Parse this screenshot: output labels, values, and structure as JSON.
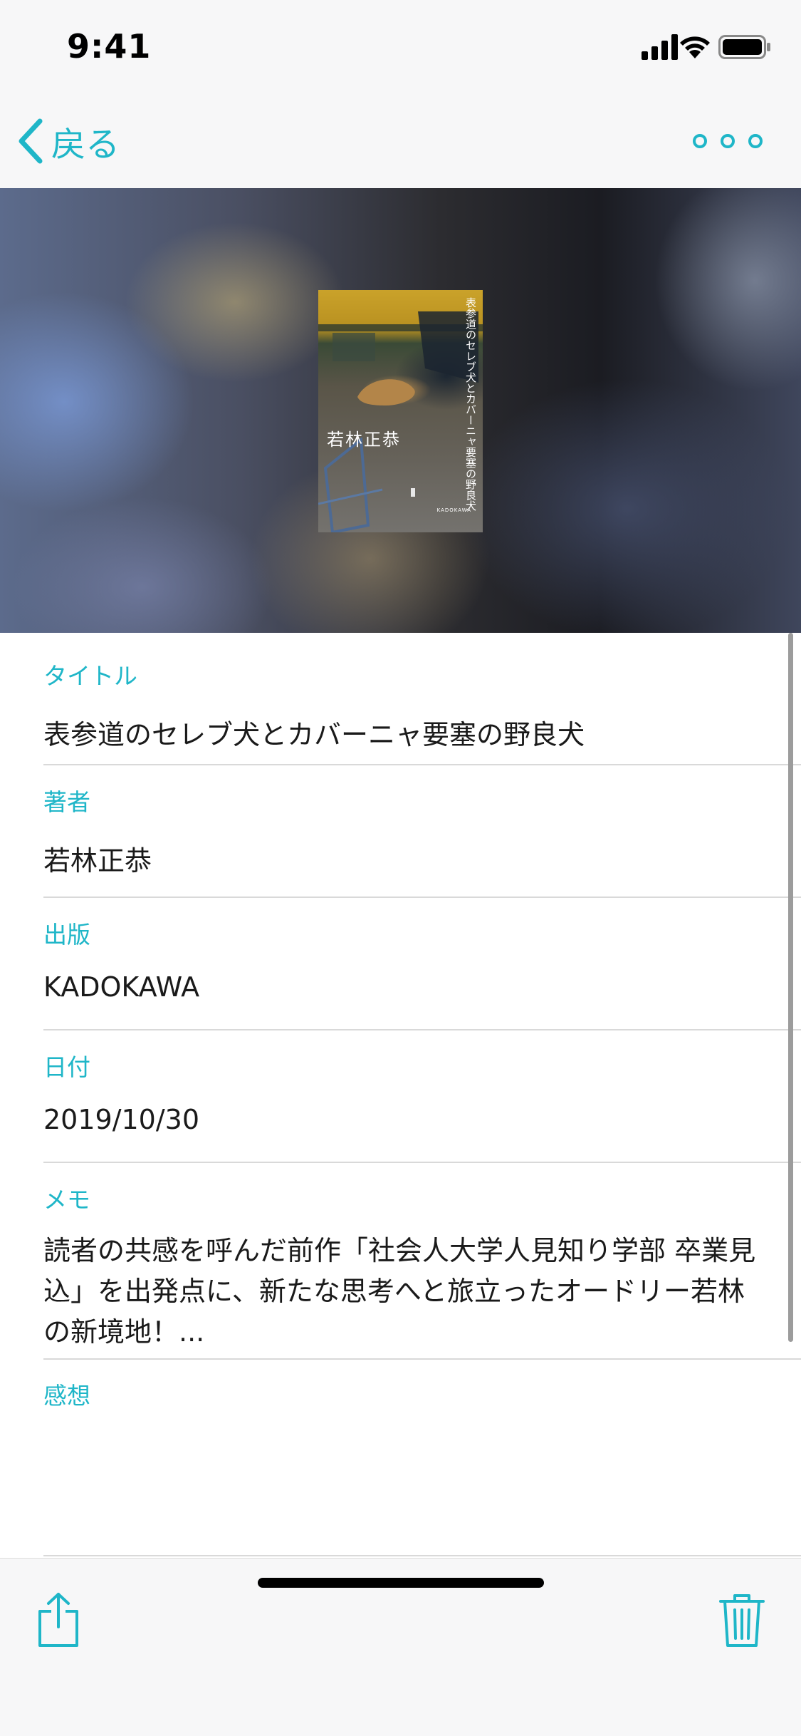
{
  "status_bar": {
    "time": "9:41",
    "icons": [
      "cellular-signal-icon",
      "wifi-icon",
      "battery-icon"
    ]
  },
  "nav": {
    "back_label": "戻る",
    "more_icon": "more-icon"
  },
  "book": {
    "cover_title": "表参道のセレブ犬とカバーニャ要塞の野良犬",
    "cover_author": "若林正恭",
    "cover_publisher": "KADOKAWA"
  },
  "fields": {
    "title": {
      "label": "タイトル",
      "value": "表参道のセレブ犬とカバーニャ要塞の野良犬"
    },
    "author": {
      "label": "著者",
      "value": "若林正恭"
    },
    "publisher": {
      "label": "出版",
      "value": "KADOKAWA"
    },
    "date": {
      "label": "日付",
      "value": "2019/10/30"
    },
    "memo": {
      "label": "メモ",
      "value": "読者の共感を呼んだ前作「社会人大学人見知り学部 卒業見込」を出発点に、新たな思考へと旅立ったオードリー若林の新境地！..."
    },
    "impression": {
      "label": "感想",
      "value": ""
    }
  },
  "toolbar": {
    "share_icon": "share-icon",
    "trash_icon": "trash-icon"
  },
  "colors": {
    "accent": "#1fb6c8",
    "text": "#1a1a1a",
    "divider": "#d9d9d9",
    "bar_background": "#f7f7f8"
  }
}
